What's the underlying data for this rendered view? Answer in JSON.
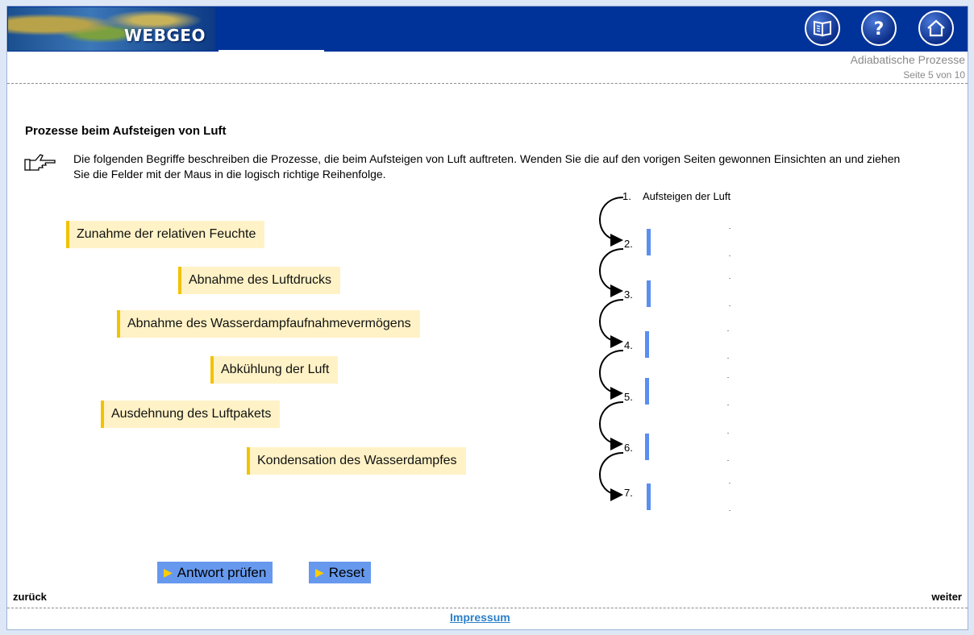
{
  "header": {
    "logo_text": "WEBGEO",
    "topic": "Adiabatische Prozesse",
    "page_counter": "Seite 5 von 10",
    "buttons": [
      "book-icon",
      "help-icon",
      "home-icon"
    ]
  },
  "main": {
    "heading": "Prozesse beim Aufsteigen von Luft",
    "instruction": "Die folgenden Begriffe beschreiben die Prozesse, die beim Aufsteigen von Luft auftreten. Wenden Sie die auf den vorigen Seiten gewonnen Einsichten an und ziehen Sie die Felder mit der Maus in die logisch richtige Reihenfolge.",
    "hint_icon": "pointing-hand-icon",
    "terms": [
      "Zunahme der relativen Feuchte",
      "Abnahme des Luftdrucks",
      "Abnahme des Wasserdampfaufnahmevermögens",
      "Abkühlung der Luft",
      "Ausdehnung des Luftpakets",
      "Kondensation des Wasserdampfes"
    ],
    "sequence": {
      "first_number": "1.",
      "first_label": "Aufsteigen der Luft",
      "numbers": [
        "2.",
        "3.",
        "4.",
        "5.",
        "6.",
        "7."
      ]
    },
    "buttons": {
      "check": "Antwort prüfen",
      "reset": "Reset"
    }
  },
  "footer": {
    "back": "zurück",
    "next": "weiter",
    "impressum": "Impressum"
  },
  "colors": {
    "header_bg": "#003399",
    "term_bg": "#fff2c6",
    "term_accent": "#f2c200",
    "slot": "#5a8ff0",
    "button_bg": "#6699ee",
    "link": "#2a7fc9"
  }
}
